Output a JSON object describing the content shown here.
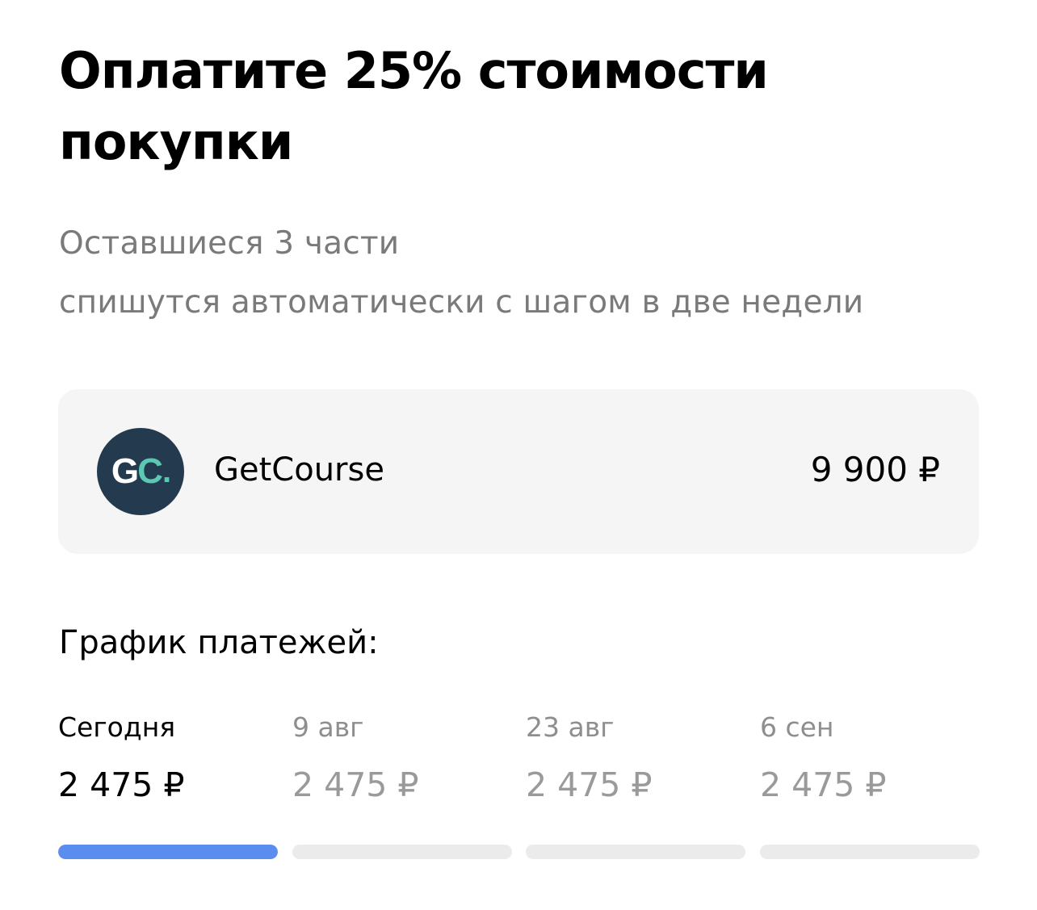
{
  "header": {
    "title": "Оплатите 25% стоимости покупки",
    "subtitle_line1": "Оставшиеся 3 части",
    "subtitle_line2": "спишутся автоматически с шагом в две недели"
  },
  "merchant": {
    "logo_text_g": "G",
    "logo_text_c": "C",
    "logo_text_dot": ".",
    "name": "GetCourse",
    "amount": "9 900 ₽",
    "logo_bg_color": "#243a4e",
    "logo_accent_color": "#5cc8b4"
  },
  "schedule": {
    "title": "График платежей:",
    "accent_color": "#5b8def",
    "payments": [
      {
        "date": "Сегодня",
        "amount": "2 475 ₽",
        "paid_fraction": 1,
        "active": true
      },
      {
        "date": "9 авг",
        "amount": "2 475 ₽",
        "paid_fraction": 0,
        "active": false
      },
      {
        "date": "23 авг",
        "amount": "2 475 ₽",
        "paid_fraction": 0,
        "active": false
      },
      {
        "date": "6 сен",
        "amount": "2 475 ₽",
        "paid_fraction": 0,
        "active": false
      }
    ]
  }
}
